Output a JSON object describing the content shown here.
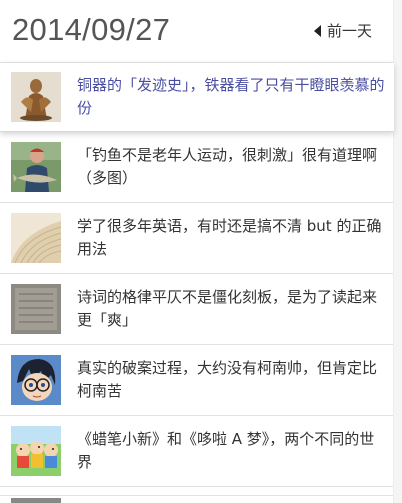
{
  "header": {
    "date": "2014/09/27",
    "prev_label": "前一天"
  },
  "items": [
    {
      "title": "铜器的「发迹史」，铁器看了只有干瞪眼羡慕的份",
      "thumb": "bronze-statue-image",
      "active": true
    },
    {
      "title": "「钓鱼不是老年人运动，很刺激」很有道理啊（多图）",
      "thumb": "fisherman-image",
      "active": false
    },
    {
      "title": "学了很多年英语，有时还是搞不清 but 的正确用法",
      "thumb": "book-pages-image",
      "active": false
    },
    {
      "title": "诗词的格律平仄不是僵化刻板，是为了读起来更「爽」",
      "thumb": "stone-tablet-image",
      "active": false
    },
    {
      "title": "真实的破案过程，大约没有柯南帅，但肯定比柯南苦",
      "thumb": "detective-cartoon-image",
      "active": false
    },
    {
      "title": "《蜡笔小新》和《哆啦 A 梦》，两个不同的世界",
      "thumb": "cartoon-kids-image",
      "active": false
    }
  ],
  "colors": {
    "active_title": "#4a4ea3",
    "title": "#333333",
    "date": "#555555"
  }
}
